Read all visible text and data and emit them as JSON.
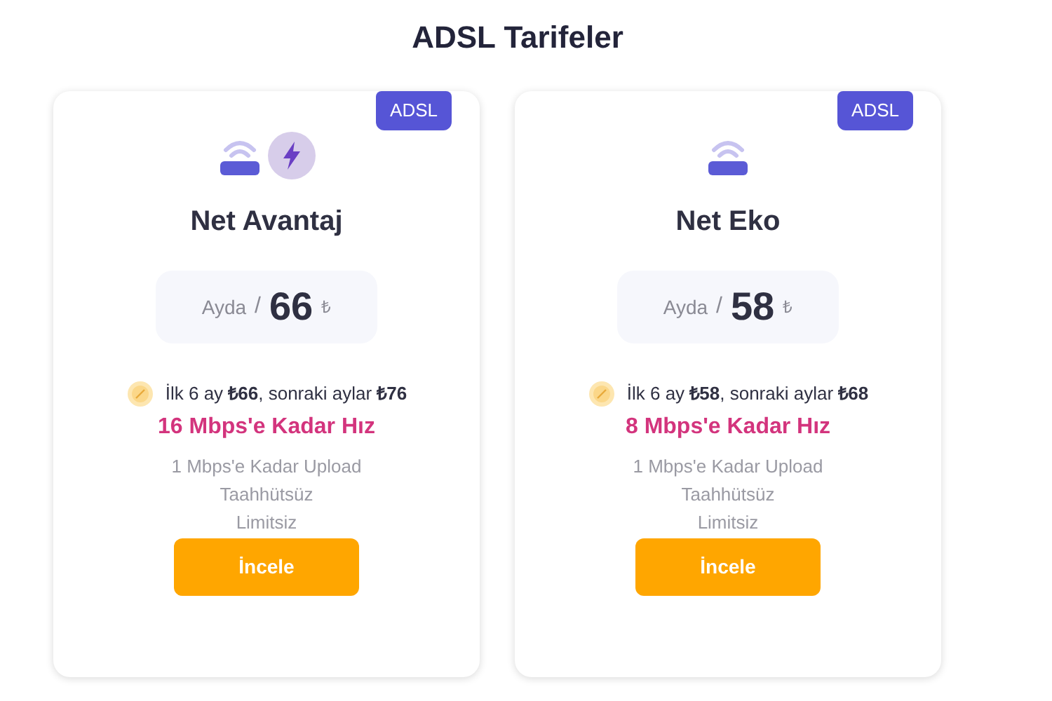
{
  "title": "ADSL Tarifeler",
  "plans": [
    {
      "badge": "ADSL",
      "boost": true,
      "name": "Net Avantaj",
      "period": "Ayda",
      "separator": "/",
      "price": "66",
      "currency": "₺",
      "promo": "İlk 6 ay **₺66**, sonraki aylar **₺76**",
      "speed": "16 Mbps'e Kadar Hız",
      "features": [
        "1 Mbps'e Kadar Upload",
        "Taahhütsüz",
        "Limitsiz"
      ],
      "button": "İncele"
    },
    {
      "badge": "ADSL",
      "boost": false,
      "name": "Net Eko",
      "period": "Ayda",
      "separator": "/",
      "price": "58",
      "currency": "₺",
      "promo": "İlk 6 ay **₺58**, sonraki aylar **₺68**",
      "speed": "8 Mbps'e Kadar Hız",
      "features": [
        "1 Mbps'e Kadar Upload",
        "Taahhütsüz",
        "Limitsiz"
      ],
      "button": "İncele"
    }
  ]
}
